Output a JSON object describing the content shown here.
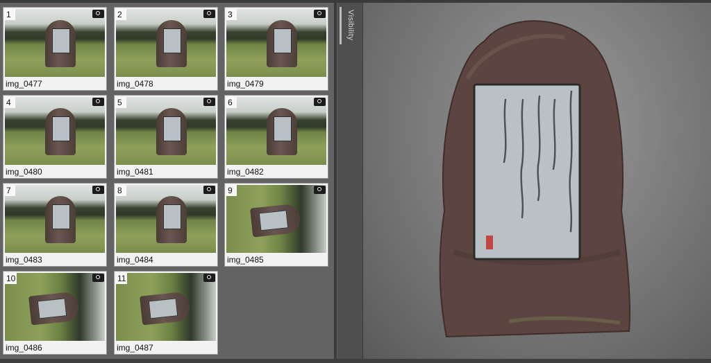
{
  "gallery": {
    "items": [
      {
        "num": "1",
        "label": "img_0477",
        "orient": "upright"
      },
      {
        "num": "2",
        "label": "img_0478",
        "orient": "upright"
      },
      {
        "num": "3",
        "label": "img_0479",
        "orient": "upright"
      },
      {
        "num": "4",
        "label": "img_0480",
        "orient": "upright"
      },
      {
        "num": "5",
        "label": "img_0481",
        "orient": "upright"
      },
      {
        "num": "6",
        "label": "img_0482",
        "orient": "upright"
      },
      {
        "num": "7",
        "label": "img_0483",
        "orient": "upright"
      },
      {
        "num": "8",
        "label": "img_0484",
        "orient": "upright"
      },
      {
        "num": "9",
        "label": "img_0485",
        "orient": "rotated"
      },
      {
        "num": "10",
        "label": "img_0486",
        "orient": "rotated"
      },
      {
        "num": "11",
        "label": "img_0487",
        "orient": "rotated"
      }
    ],
    "thumbnail_icon": "camera-icon"
  },
  "visibility_tab": {
    "label": "Visibility"
  },
  "viewport": {
    "content": "3d-stone-monument-model",
    "colors": {
      "stone": "#5c4540",
      "plate": "#b9c1c5",
      "seal": "#c0302a"
    }
  }
}
